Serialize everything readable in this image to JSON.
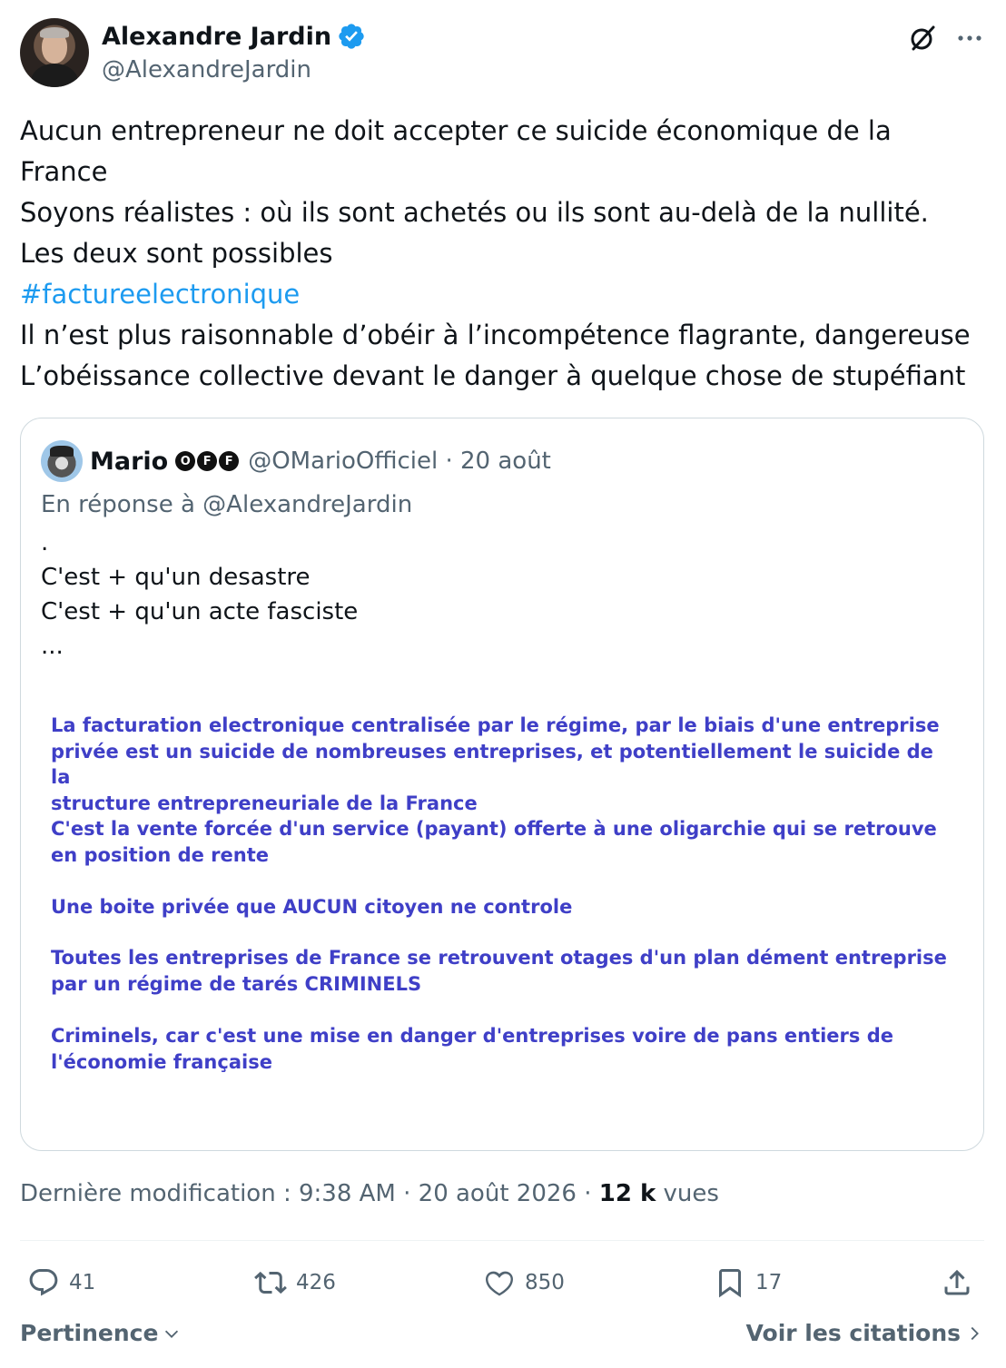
{
  "author": {
    "display_name": "Alexandre Jardin",
    "handle": "@AlexandreJardin"
  },
  "tweet": {
    "lines": [
      "Aucun entrepreneur ne doit accepter ce suicide économique de la",
      "France",
      "Soyons réalistes : où ils sont achetés ou ils sont au-delà de la nullité.",
      "Les deux sont possibles",
      "#factureelectronique",
      "Il n’est plus raisonnable d’obéir à l’incompétence flagrante, dangereuse",
      "L’obéissance collective devant le danger à quelque chose de stupéfiant"
    ]
  },
  "quote": {
    "display_name": "Mario",
    "badges": [
      "O",
      "F",
      "F"
    ],
    "handle_date": "@OMarioOfficiel · 20 août",
    "reply_to": "En réponse à @AlexandreJardin",
    "lines": [
      ".",
      "C'est + qu'un desastre",
      "C'est + qu'un acte fasciste",
      "..."
    ],
    "image_paragraphs": [
      "La facturation electronique centralisée par le régime, par le biais d'une entreprise\nprivée est un suicide de nombreuses entreprises, et potentiellement le suicide de la\nstructure entrepreneuriale de la France",
      "C'est la vente forcée d'un service (payant) offerte à une oligarchie qui se retrouve\nen position de rente",
      "Une boite privée que AUCUN citoyen ne controle",
      "Toutes les entreprises de France se retrouvent otages d'un plan dément entreprise\npar un régime de tarés CRIMINELS",
      "Criminels, car c'est une mise en danger d'entreprises voire de pans entiers de\nl'économie française"
    ]
  },
  "meta": {
    "edited": "Dernière modification : 9:38 AM · 20 août 2026 · ",
    "views_count": "12 k",
    "views_label": " vues"
  },
  "actions": {
    "replies": "41",
    "reposts": "426",
    "likes": "850",
    "bookmarks": "17"
  },
  "footer": {
    "sort": "Pertinence",
    "quotes_link": "Voir les citations"
  },
  "colors": {
    "link": "#1d9bf0",
    "secondary_text": "#536471",
    "image_text": "#3f3fc7"
  }
}
